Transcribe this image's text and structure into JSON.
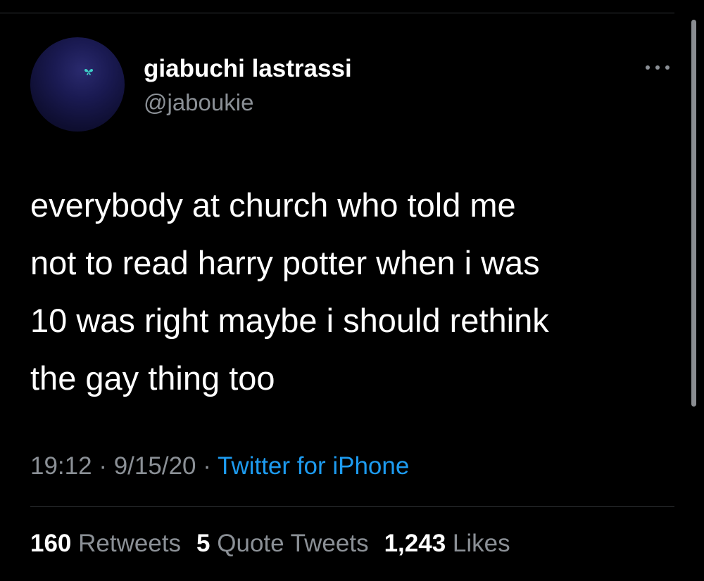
{
  "author": {
    "display_name": "giabuchi lastrassi",
    "handle": "@jaboukie"
  },
  "tweet": {
    "text_lines": [
      "everybody at church who told me",
      "not to read harry potter when i was",
      "10 was right maybe i should rethink",
      "the gay thing too"
    ]
  },
  "meta": {
    "time": "19:12",
    "separator": "·",
    "date": "9/15/20",
    "source": "Twitter for iPhone"
  },
  "stats": {
    "retweets_count": "160",
    "retweets_label": "Retweets",
    "quotes_count": "5",
    "quotes_label": "Quote Tweets",
    "likes_count": "1,243",
    "likes_label": "Likes"
  },
  "icons": {
    "more": "more-horizontal-icon",
    "avatar_mark": "butterfly-icon"
  },
  "colors": {
    "background": "#000000",
    "primary_text": "#ffffff",
    "secondary_text": "#8b9096",
    "link": "#1d9bf0",
    "divider": "#2f3336"
  }
}
